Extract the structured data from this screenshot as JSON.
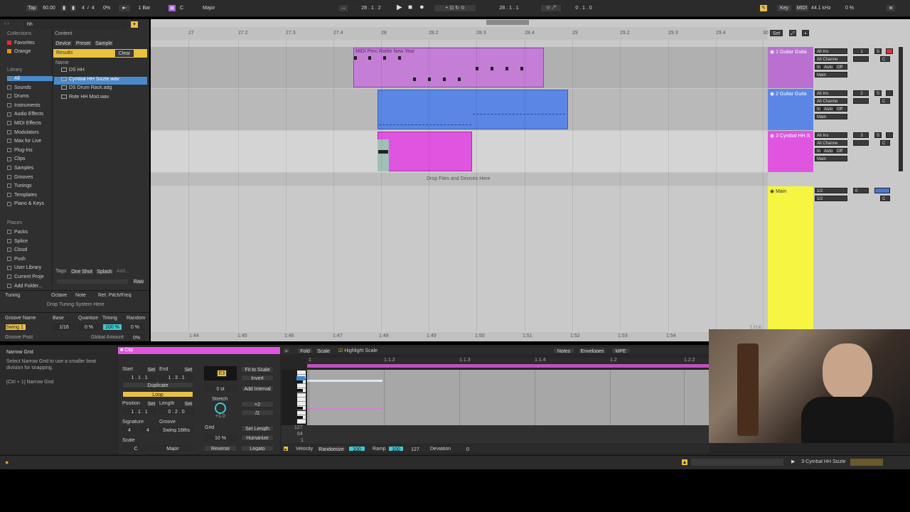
{
  "topbar": {
    "tap": "Tap",
    "tempo": "60.00",
    "sig_num": "4",
    "sig_den": "4",
    "percent": "0%",
    "quant": "1 Bar",
    "key": "C",
    "scale": "Major",
    "position": "28 .  1 .  2",
    "loop_pos": "28 .  1 .  1",
    "loop_len": "0 .  1 .  0",
    "key_label": "Key",
    "midi_label": "MIDI",
    "sample_rate": "44.1 kHz",
    "cpu": "0 %"
  },
  "browser": {
    "search": "hh",
    "collections_label": "Collections",
    "collections": [
      "Favorites",
      "Orange"
    ],
    "library_label": "Library",
    "library_items": [
      "All",
      "Sounds",
      "Drums",
      "Instruments",
      "Audio Effects",
      "MIDI Effects",
      "Modulators",
      "Max for Live",
      "Plug-Ins",
      "Clips",
      "Samples",
      "Grooves",
      "Tunings",
      "Templates",
      "Piano & Keys"
    ],
    "places_label": "Places",
    "places": [
      "Packs",
      "Splice",
      "Cloud",
      "Push",
      "User Library",
      "Current Proje",
      "Add Folder..."
    ],
    "content_label": "Content",
    "filters": [
      "Device",
      "Preset",
      "Sample"
    ],
    "results_label": "Results",
    "clear_label": "Clear",
    "name_header": "Name",
    "results": [
      "DS HH",
      "Cymbal HH Sizzle.wav",
      "DS Drum Rack.adg",
      "Ride HH Mod.wav"
    ],
    "tags_label": "Tags:",
    "tags": [
      "One Shot",
      "Splash",
      "Add..."
    ],
    "raw_label": "Raw",
    "tuning_headers": [
      "Tuning",
      "Octave",
      "Note",
      "Ref. Pitch/Freq"
    ],
    "tuning_drop": "Drop Tuning System Here",
    "groove_headers": [
      "Groove Name",
      "Base",
      "Quantize",
      "Timing",
      "Random"
    ],
    "groove_row": [
      "Swing 1",
      "1/16",
      "0 %",
      "100 %",
      "0 %"
    ],
    "groove_pool": "Groove Pool",
    "global_amount_label": "Global Amount",
    "global_amount": "0%"
  },
  "arrangement": {
    "ruler": [
      "27",
      "27.2",
      "27.3",
      "27.4",
      "28",
      "28.2",
      "28.3",
      "28.4",
      "29",
      "29.2",
      "29.3",
      "29.4",
      "30"
    ],
    "time_ruler": [
      "1:44",
      "1:45",
      "1:46",
      "1:47",
      "1:48",
      "1:49",
      "1:50",
      "1:51",
      "1:52",
      "1:53",
      "1:54"
    ],
    "set_label": "Set",
    "clip1_name": "MIDI Perc Rattle New Year",
    "drop_text": "Drop Files and Devices Here",
    "quant_display": "1/16",
    "tracks": [
      {
        "name": "1 Guitar Guita",
        "input": "All Ins",
        "channel": "All Channe",
        "num": "1",
        "out": "Main",
        "color": "#b970d0"
      },
      {
        "name": "2 Guitar Guita",
        "input": "All Ins",
        "channel": "All Channe",
        "num": "2",
        "out": "Main",
        "color": "#5b86e6"
      },
      {
        "name": "3 Cymbal HH S",
        "input": "All Ins",
        "channel": "All Channe",
        "num": "3",
        "out": "Main",
        "color": "#e055e0"
      }
    ],
    "main_name": "Main",
    "main_io": [
      "1/2",
      "1/2"
    ],
    "monitor": [
      "In",
      "Auto",
      "Off"
    ],
    "solo": "S",
    "mute_c": "C"
  },
  "clip_view": {
    "info_title": "Narrow Grid",
    "info_text": "Select Narrow Grid to use a smaller beat division for snapping.",
    "info_shortcut": "[Ctrl + 1] Narrow Grid",
    "clip_label": "Clip",
    "start_label": "Start",
    "end_label": "End",
    "set_label": "Set",
    "start_val": "1 .  1 .  1",
    "end_val": "1 .  3 .  1",
    "duplicate": "Duplicate",
    "loop": "Loop",
    "position_label": "Position",
    "length_label": "Length",
    "position_val": "1 .  1 .  1",
    "length_val": "0 .  2 .  0",
    "signature_label": "Signature",
    "groove_label": "Groove",
    "sig_num": "4",
    "sig_den": "4",
    "groove_val": "Swing 16ths",
    "scale_label": "Scale",
    "scale_key": "C",
    "scale_mode": "Major",
    "note_display": "E3",
    "semitone": "0 st",
    "stretch_label": "Stretch",
    "stretch_val": "+1.0",
    "grid_label": "Grid",
    "grid_pct": "10 %",
    "fit_scale": "Fit to Scale",
    "invert": "Invert",
    "add_interval": "Add Interval",
    "x2": "×2",
    "div2": "/2",
    "set_length": "Set Length",
    "humanize": "Humanize",
    "reverse": "Reverse",
    "legato": "Legato",
    "fold": "Fold",
    "scale_btn": "Scale",
    "highlight_scale": "Highlight Scale",
    "tabs": [
      "Notes",
      "Envelopes",
      "MPE"
    ],
    "ruler": [
      "1",
      "1.1.2",
      "1.1.3",
      "1.1.4",
      "1.2",
      "1.2.2"
    ],
    "vel_values": [
      "127",
      "64",
      "1"
    ],
    "velocity_label": "Velocity",
    "randomize": "Randomize",
    "vel_val": "100",
    "ramp_label": "Ramp",
    "ramp_a": "100",
    "ramp_b": "127",
    "deviation_label": "Deviation",
    "deviation_val": "0"
  },
  "status": {
    "track_name": "3-Cymbal HH Sizzle"
  }
}
